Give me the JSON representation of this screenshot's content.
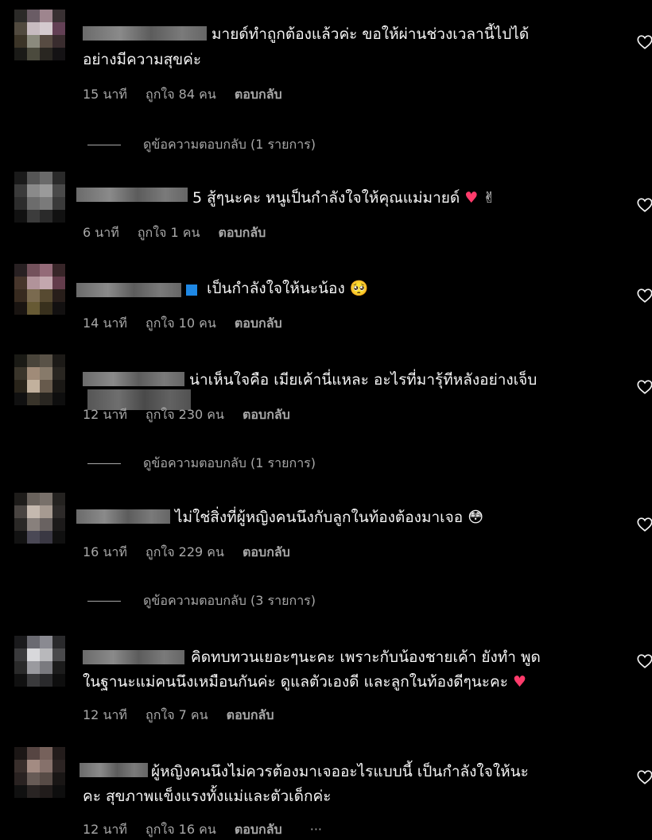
{
  "comments": [
    {
      "text1": "มายด์ทำถูกต้องแล้วค่ะ ขอให้ผ่านช่วงเวลานี้ไปได้",
      "text2": "อย่างมีความสุขค่ะ",
      "time": "15 นาที",
      "likes": "ถูกใจ 84 คน",
      "reply": "ตอบกลับ",
      "view_replies": "ดูข้อความตอบกลับ (1 รายการ)"
    },
    {
      "text1": "5 สู้ๆนะคะ หนูเป็นกำลังใจให้คุณแม่มายด์",
      "time": "6 นาที",
      "likes": "ถูกใจ 1 คน",
      "reply": "ตอบกลับ"
    },
    {
      "text1": "เป็นกำลังใจให้นะน้อง",
      "time": "14 นาที",
      "likes": "ถูกใจ 10 คน",
      "reply": "ตอบกลับ"
    },
    {
      "text1": "น่าเห็นใจคือ เมียเค้านี่แหละ อะไรที่มารุ้ทีหลังอย่างเจ็บ",
      "time": "12 นาที",
      "likes": "ถูกใจ 230 คน",
      "reply": "ตอบกลับ",
      "view_replies": "ดูข้อความตอบกลับ (1 รายการ)"
    },
    {
      "text1": "ไม่ใช่สิ่งที่ผู้หญิงคนนึงกับลูกในท้องต้องมาเจอ",
      "time": "16 นาที",
      "likes": "ถูกใจ 229 คน",
      "reply": "ตอบกลับ",
      "view_replies": "ดูข้อความตอบกลับ (3 รายการ)"
    },
    {
      "text1": "คิดทบทวนเยอะๆนะคะ เพราะกับน้องชายเค้า ยังทำ พูด",
      "text2": "ในฐานะแม่คนนึงเหมือนกันค่ะ ดูแลตัวเองดี และลูกในท้องดีๆนะคะ",
      "time": "12 นาที",
      "likes": "ถูกใจ 7 คน",
      "reply": "ตอบกลับ"
    },
    {
      "text1": "ผู้หญิงคนนึงไม่ควรต้องมาเจออะไรแบบนี้ เป็นกำลังใจให้นะ",
      "text2": "คะ สุขภาพแข็งแรงทั้งแม่และตัวเด็กค่ะ",
      "time": "12 นาที",
      "likes": "ถูกใจ 16 คน",
      "reply": "ตอบกลับ",
      "more": "···"
    }
  ],
  "icons": {
    "heart": "heart-outline-icon",
    "red_heart_emoji": "red-heart-emoji",
    "victory_emoji": "victory-hand-emoji",
    "crying_emoji": "pleading-face-emoji",
    "flushed_emoji": "flushed-face-emoji"
  },
  "colors": {
    "background": "#000000",
    "text": "#f5f5f5",
    "meta": "#a8a8a8",
    "heart_emoji": "#ff3b6b"
  }
}
